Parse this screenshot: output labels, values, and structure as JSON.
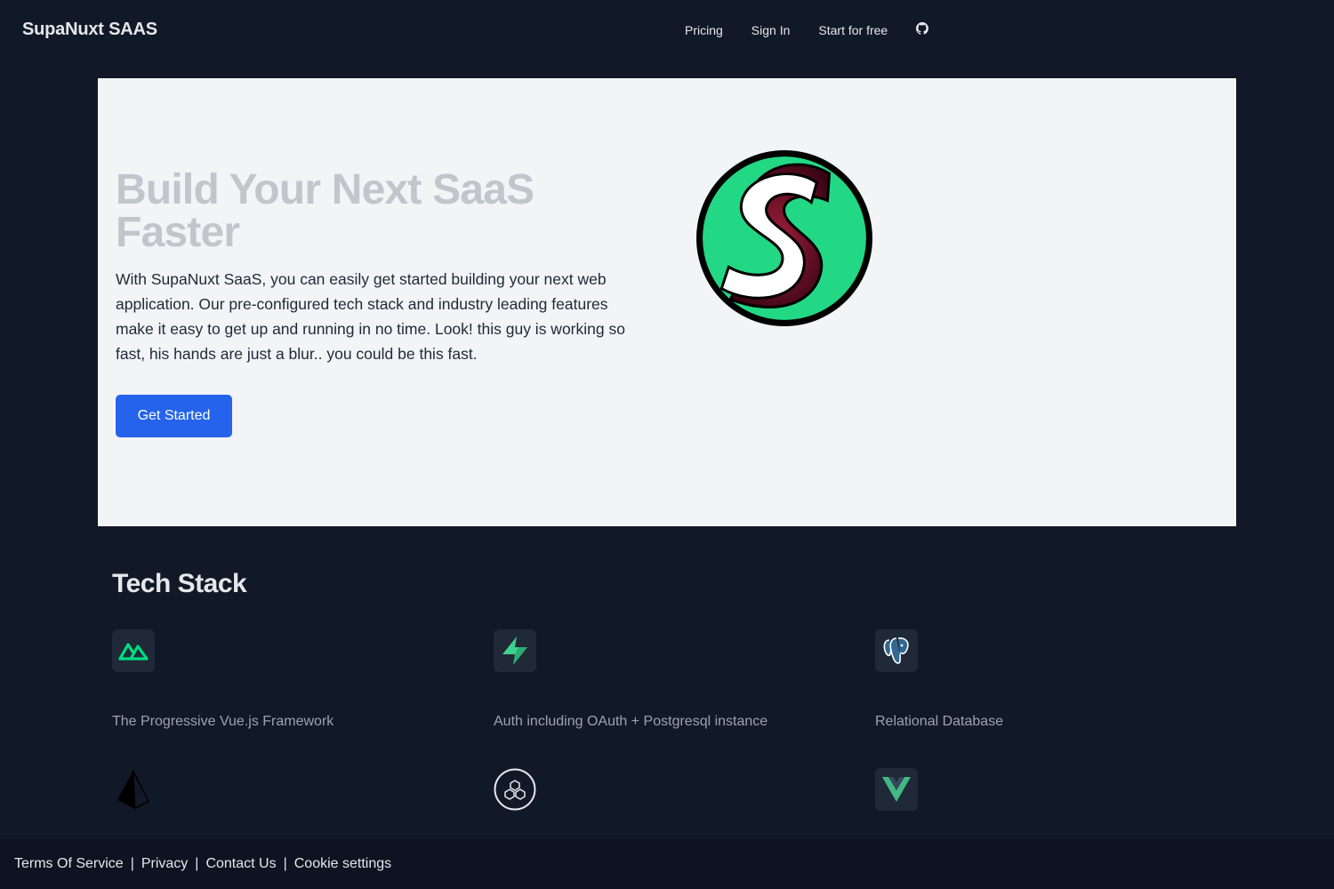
{
  "header": {
    "brand": "SupaNuxt SAAS",
    "nav": {
      "pricing": "Pricing",
      "sign_in": "Sign In",
      "start_free": "Start for free",
      "github_icon": "github-icon"
    }
  },
  "hero": {
    "title": "Build Your Next SaaS Faster",
    "description": "With SupaNuxt SaaS, you can easily get started building your next web application. Our pre-configured tech stack and industry leading features make it easy to get up and running in no time. Look! this guy is working so fast, his hands are just a blur.. you could be this fast.",
    "cta_label": "Get Started",
    "logo_icon": "supanuxt-s-logo"
  },
  "tech_stack": {
    "title": "Tech Stack",
    "items": [
      {
        "icon": "nuxt-icon",
        "description": "The Progressive Vue.js Framework"
      },
      {
        "icon": "supabase-icon",
        "description": "Auth including OAuth + Postgresql instance"
      },
      {
        "icon": "postgresql-icon",
        "description": "Relational Database"
      },
      {
        "icon": "prisma-icon",
        "description": ""
      },
      {
        "icon": "trpc-icon",
        "description": ""
      },
      {
        "icon": "vue-icon",
        "description": ""
      }
    ]
  },
  "footer": {
    "terms": "Terms Of Service",
    "privacy": "Privacy",
    "contact": "Contact Us",
    "cookies": "Cookie settings",
    "separator": "|"
  },
  "colors": {
    "background": "#111827",
    "hero_background": "#f3f4f6",
    "accent": "#2563eb",
    "logo_green": "#22d885",
    "logo_maroon": "#5a0a1e"
  }
}
